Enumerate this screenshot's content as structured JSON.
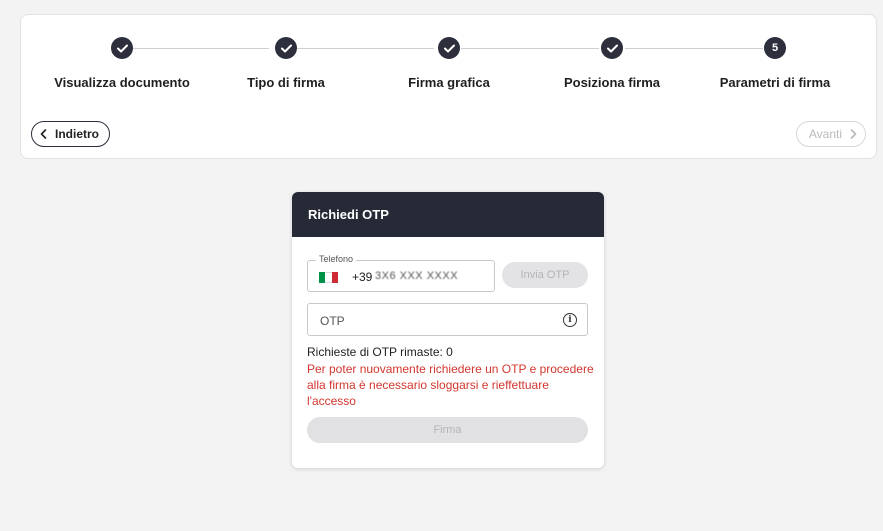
{
  "stepper": {
    "steps": [
      {
        "label": "Visualizza documento",
        "status": "done"
      },
      {
        "label": "Tipo di firma",
        "status": "done"
      },
      {
        "label": "Firma grafica",
        "status": "done"
      },
      {
        "label": "Posiziona firma",
        "status": "done"
      },
      {
        "label": "Parametri di firma",
        "status": "current",
        "number": "5"
      }
    ],
    "back_label": "Indietro",
    "next_label": "Avanti"
  },
  "otp": {
    "title": "Richiedi OTP",
    "phone_legend": "Telefono",
    "phone_prefix": "+39",
    "phone_masked": "3X6 XXX XXXX",
    "send_label": "Invia OTP",
    "otp_placeholder": "OTP",
    "remaining": "Richieste di OTP rimaste: 0",
    "warning": "Per poter nuovamente richiedere un OTP e procedere alla firma è necessario sloggarsi e rieffettuare l'accesso",
    "sign_label": "Firma"
  },
  "colors": {
    "header_bg": "#262a37",
    "step_circle": "#2d2f3c",
    "warning_text": "#d2372e",
    "flag_green": "#009246",
    "flag_white": "#ffffff",
    "flag_red": "#ce2b37"
  },
  "icons": {
    "step_done": "check-icon",
    "back": "chevron-left-icon",
    "next": "chevron-right-icon",
    "info": "info-circle-icon",
    "flag": "italy-flag-icon"
  }
}
